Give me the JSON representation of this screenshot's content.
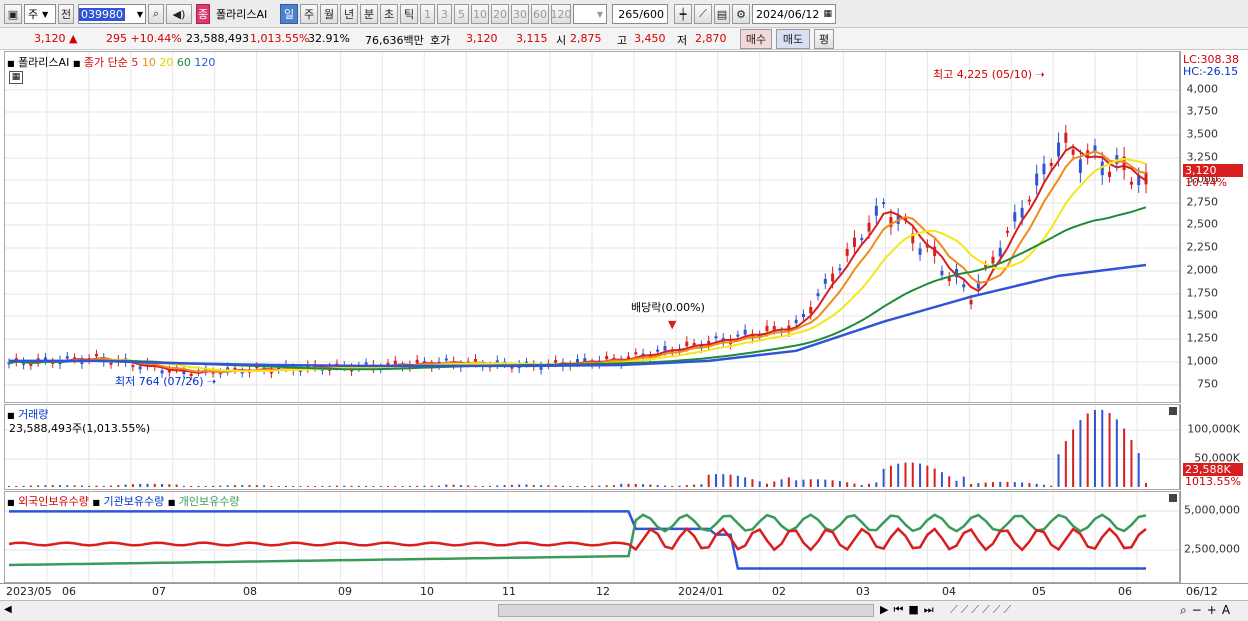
{
  "toolbar": {
    "market": "주",
    "prev": "전",
    "code": "039980",
    "badge": "종",
    "name": "폴라리스AI",
    "periods": [
      "일",
      "주",
      "월",
      "년",
      "분",
      "초",
      "틱"
    ],
    "nums": [
      "1",
      "3",
      "5",
      "10",
      "20",
      "30",
      "60",
      "120"
    ],
    "count": "265/600",
    "date": "2024/06/12"
  },
  "quote": {
    "price": "3,120 ▲",
    "change": "295 +10.44%",
    "volume": "23,588,493",
    "vol_ratio": "1,013.55%",
    "turnover": "32.91%",
    "amount": "76,636백만",
    "hoga_label": "호가",
    "hoga": "3,120",
    "hoga2": "3,115",
    "open_label": "시",
    "open": "2,875",
    "high_label": "고",
    "high": "3,450",
    "low_label": "저",
    "low": "2,870",
    "buy": "매수",
    "sell": "매도",
    "eval": "평"
  },
  "price_panel": {
    "title": "폴라리스AI",
    "ma_label": "종가 단순",
    "ma": [
      "5",
      "10",
      "20",
      "60",
      "120"
    ],
    "ma_colors": [
      "#d81e1e",
      "#f08a1a",
      "#f2e81a",
      "#1f8a3a",
      "#2f55d6"
    ],
    "lc": "LC:308.38",
    "hc": "HC:-26.15",
    "high_note": "최고 4,225 (05/10)",
    "low_note": "최저 764 (07/26)",
    "div_note": "배당락(0.00%)",
    "yticks": [
      "4,000",
      "3,750",
      "3,500",
      "3,250",
      "3,000",
      "2,750",
      "2,500",
      "2,250",
      "2,000",
      "1,750",
      "1,500",
      "1,250",
      "1,000",
      "750"
    ],
    "price_tag": "3,120",
    "pct_tag": "10.44%"
  },
  "volume_panel": {
    "title": "거래량",
    "value": "23,588,493주(1,013.55%)",
    "yticks": [
      "100,000K",
      "50,000K"
    ],
    "tag": "23,588K",
    "pct": "1013.55%"
  },
  "holding_panel": {
    "items": [
      "외국인보유수량",
      "기관보유수량",
      "개인보유수량"
    ],
    "colors": [
      "#d81e1e",
      "#2f55d6",
      "#3a9a5a"
    ],
    "yticks": [
      "5,000,000",
      "2,500,000"
    ]
  },
  "xaxis": [
    "2023/05",
    "06",
    "07",
    "08",
    "09",
    "10",
    "11",
    "12",
    "2024/01",
    "02",
    "03",
    "04",
    "05",
    "06",
    "06/12"
  ],
  "chart_data": {
    "type": "candlestick",
    "title": "폴라리스AI",
    "x": [
      "2023/05",
      "2023/06",
      "2023/07",
      "2023/08",
      "2023/09",
      "2023/10",
      "2023/11",
      "2023/12",
      "2024/01",
      "2024/02",
      "2024/03",
      "2024/04",
      "2024/05",
      "2024/06"
    ],
    "close_approx": [
      900,
      960,
      790,
      830,
      860,
      910,
      870,
      950,
      1150,
      1350,
      2800,
      1700,
      3500,
      3120
    ],
    "ma120_approx": [
      930,
      930,
      900,
      880,
      870,
      870,
      870,
      880,
      930,
      1050,
      1400,
      1700,
      1950,
      2080
    ],
    "volume_k_approx": [
      3000,
      5000,
      3000,
      2000,
      2000,
      4000,
      3000,
      5000,
      20000,
      12000,
      38000,
      8000,
      120000,
      23588
    ],
    "ylim": [
      700,
      4300
    ],
    "series": [
      {
        "name": "5"
      },
      {
        "name": "10"
      },
      {
        "name": "20"
      },
      {
        "name": "60"
      },
      {
        "name": "120"
      }
    ]
  }
}
